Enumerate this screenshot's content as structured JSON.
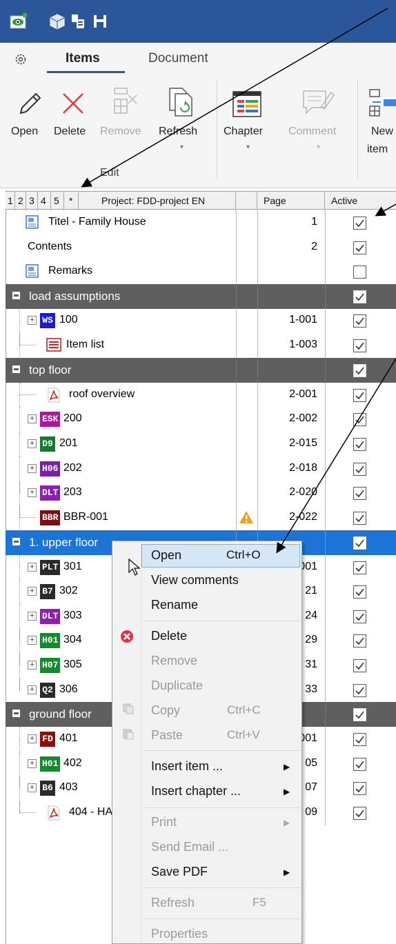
{
  "ribbon": {
    "tabs": [
      "Items",
      "Document"
    ],
    "buttons": {
      "open": "Open",
      "delete": "Delete",
      "remove": "Remove",
      "refresh": "Refresh",
      "chapter": "Chapter",
      "comment": "Comment",
      "new_item_line1": "New",
      "new_item_line2": "item"
    },
    "group_label": "Edit"
  },
  "grid": {
    "levels": [
      "1",
      "2",
      "3",
      "4",
      "5",
      "*"
    ],
    "project_label": "Project: FDD-project EN",
    "col_page": "Page",
    "col_active": "Active",
    "rows": [
      {
        "label": "Titel - Family House",
        "page": "1",
        "active": true
      },
      {
        "label": "Contents",
        "page": "2",
        "active": true
      },
      {
        "label": "Remarks",
        "page": "",
        "active": false
      },
      {
        "label": "load assumptions",
        "page": "",
        "active": true
      },
      {
        "badge": "WS",
        "label": "100",
        "page": "1-001",
        "active": true
      },
      {
        "label": "Item list",
        "page": "1-003",
        "active": true
      },
      {
        "label": "top floor",
        "page": "",
        "active": true
      },
      {
        "label": "roof overview",
        "page": "2-001",
        "active": true
      },
      {
        "badge": "ESK",
        "label": "200",
        "page": "2-002",
        "active": true
      },
      {
        "badge": "D9",
        "label": "201",
        "page": "2-015",
        "active": true
      },
      {
        "badge": "H06",
        "label": "202",
        "page": "2-018",
        "active": true
      },
      {
        "badge": "DLT",
        "label": "203",
        "page": "2-020",
        "active": true
      },
      {
        "badge": "BBR",
        "label": "BBR-001",
        "page": "2-022",
        "active": true
      },
      {
        "label": "1. upper floor",
        "page": "",
        "active": true
      },
      {
        "badge": "PLT",
        "label": "301",
        "page": "001",
        "active": true
      },
      {
        "badge": "B7",
        "label": "302",
        "page": "21",
        "active": true
      },
      {
        "badge": "DLT",
        "label": "303",
        "page": "24",
        "active": true
      },
      {
        "badge": "H01",
        "label": "304",
        "page": "29",
        "active": true
      },
      {
        "badge": "H07",
        "label": "305",
        "page": "31",
        "active": true
      },
      {
        "badge": "Q2",
        "label": "306",
        "page": "33",
        "active": true
      },
      {
        "label": "ground floor",
        "page": "",
        "active": true
      },
      {
        "badge": "FD",
        "label": "401",
        "page": "001",
        "active": true
      },
      {
        "badge": "H01",
        "label": "402",
        "page": "05",
        "active": true
      },
      {
        "badge": "B6",
        "label": "403",
        "page": "07",
        "active": true
      },
      {
        "label": "404 - HA",
        "page": "09",
        "active": true
      }
    ]
  },
  "context_menu": {
    "open": "Open",
    "open_sc": "Ctrl+O",
    "view_comments": "View comments",
    "rename": "Rename",
    "delete": "Delete",
    "remove": "Remove",
    "duplicate": "Duplicate",
    "copy": "Copy",
    "copy_sc": "Ctrl+C",
    "paste": "Paste",
    "paste_sc": "Ctrl+V",
    "insert_item": "Insert item ...",
    "insert_chapter": "Insert chapter ...",
    "print": "Print",
    "send_email": "Send Email ...",
    "save_pdf": "Save PDF",
    "refresh": "Refresh",
    "refresh_sc": "F5",
    "properties": "Properties"
  },
  "colors": {
    "titlebar": "#2b579a",
    "chapter_row": "#5f5f5f",
    "selected_row": "#1b74d6",
    "badges": {
      "WS": "#1a1ad0",
      "ESK": "#b0159c",
      "D9": "#137a2e",
      "H06": "#7a1fa8",
      "DLT": "#8a1fb0",
      "BBR": "#7a1010",
      "PLT": "#2a2a2a",
      "B7": "#2a2a2a",
      "H01": "#138a2e",
      "H07": "#138a2e",
      "Q2": "#2a2a2a",
      "FD": "#8a1010",
      "B6": "#2a2a2a"
    }
  }
}
